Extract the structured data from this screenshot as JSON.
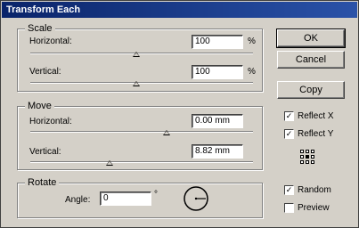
{
  "window": {
    "title": "Transform Each"
  },
  "scale": {
    "group_title": "Scale",
    "horizontal_label": "Horizontal:",
    "horizontal_value": "100",
    "horizontal_unit": "%",
    "vertical_label": "Vertical:",
    "vertical_value": "100",
    "vertical_unit": "%"
  },
  "move": {
    "group_title": "Move",
    "horizontal_label": "Horizontal:",
    "horizontal_value": "0.00 mm",
    "vertical_label": "Vertical:",
    "vertical_value": "8.82 mm"
  },
  "rotate": {
    "group_title": "Rotate",
    "angle_label": "Angle:",
    "angle_value": "0",
    "angle_unit": "°"
  },
  "buttons": {
    "ok": "OK",
    "cancel": "Cancel",
    "copy": "Copy"
  },
  "options": {
    "reflect_x": {
      "label": "Reflect X",
      "checked": true
    },
    "reflect_y": {
      "label": "Reflect Y",
      "checked": true
    },
    "random": {
      "label": "Random",
      "checked": true
    },
    "preview": {
      "label": "Preview",
      "checked": false
    }
  },
  "reference_point": {
    "selected": "center"
  }
}
